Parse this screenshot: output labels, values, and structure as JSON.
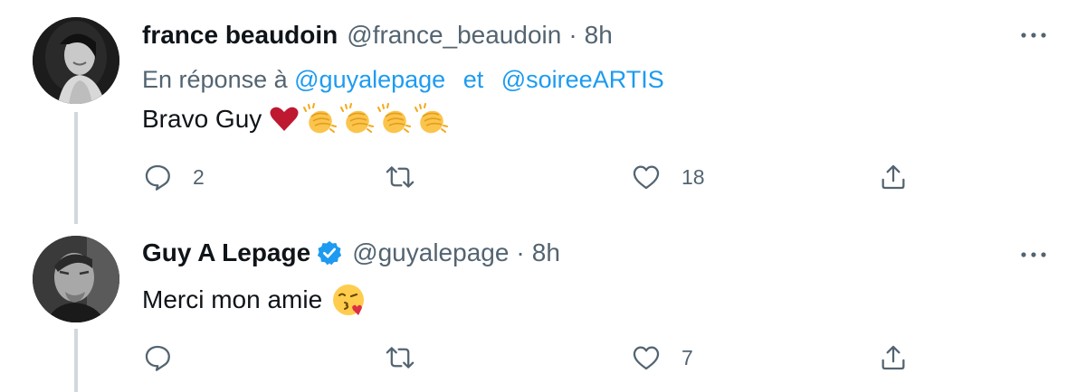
{
  "tweets": [
    {
      "display_name": "france beaudoin",
      "handle": "@france_beaudoin",
      "separator": "·",
      "time": "8h",
      "verified": false,
      "reply_prefix": "En réponse à",
      "reply_mentions": [
        "@guyalepage",
        "@soireeARTIS"
      ],
      "reply_joiner": "et",
      "text": "Bravo Guy",
      "emojis": [
        "red-heart",
        "clapping-hands",
        "clapping-hands",
        "clapping-hands",
        "clapping-hands"
      ],
      "reply_count": "2",
      "retweet_count": "",
      "like_count": "18"
    },
    {
      "display_name": "Guy A Lepage",
      "handle": "@guyalepage",
      "separator": "·",
      "time": "8h",
      "verified": true,
      "text": "Merci mon amie",
      "emojis": [
        "face-blowing-a-kiss"
      ],
      "reply_count": "",
      "retweet_count": "",
      "like_count": "7"
    }
  ],
  "colors": {
    "text_primary": "#0f1419",
    "text_secondary": "#536471",
    "link": "#1d9bf0",
    "thread_line": "#cfd9de",
    "verified_badge": "#1d9bf0"
  },
  "icons": {
    "more": "more-horizontal-icon",
    "reply": "reply-icon",
    "retweet": "retweet-icon",
    "like": "like-icon",
    "share": "share-icon",
    "verified": "verified-badge-icon"
  }
}
